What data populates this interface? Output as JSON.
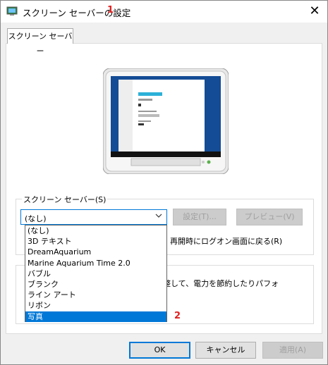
{
  "window": {
    "title": "スクリーン セーバーの設定",
    "close_glyph": "✕"
  },
  "annotations": {
    "marker1": "1",
    "marker2": "2"
  },
  "tab": {
    "label": "スクリーン セーバー"
  },
  "screensaver": {
    "group_label": "スクリーン セーバー(S)",
    "selected": "(なし)",
    "settings_button": "設定(T)...",
    "preview_button": "プレビュー(V)",
    "resume_label": "再開時にログオン画面に戻る(R)",
    "options": [
      "(なし)",
      "3D テキスト",
      "DreamAquarium",
      "Marine Aquarium Time 2.0",
      "バブル",
      "ブランク",
      "ライン アート",
      "リボン",
      "写真"
    ],
    "highlighted_option": "写真"
  },
  "power": {
    "text": "整して、電力を節約したりパフォ"
  },
  "footer": {
    "ok": "OK",
    "cancel": "キャンセル",
    "apply": "適用(A)"
  },
  "colors": {
    "accent": "#0078d7",
    "annotation": "#e02020"
  }
}
